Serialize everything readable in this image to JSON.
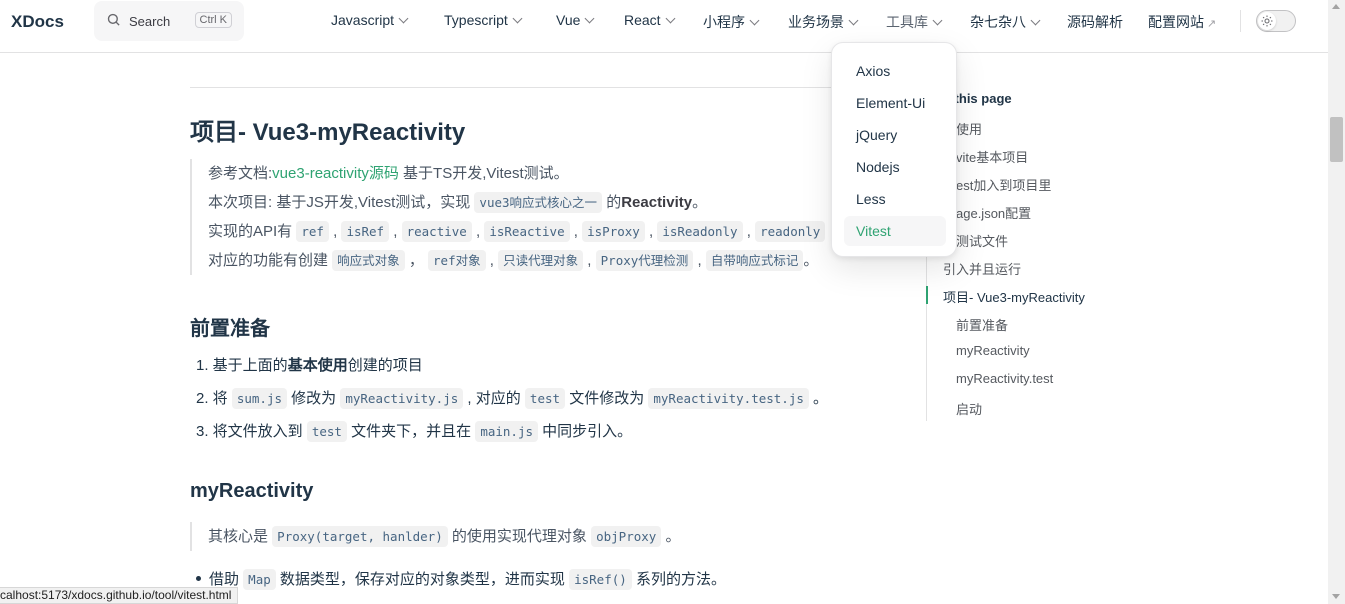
{
  "nav": {
    "logo": "XDocs",
    "search_placeholder": "Search",
    "search_shortcut": "Ctrl K",
    "items": [
      {
        "label": "Javascript",
        "dropdown": true
      },
      {
        "label": "Typescript",
        "dropdown": true
      },
      {
        "label": "Vue",
        "dropdown": true
      },
      {
        "label": "React",
        "dropdown": true
      },
      {
        "label": "小程序",
        "dropdown": true
      },
      {
        "label": "业务场景",
        "dropdown": true
      },
      {
        "label": "工具库",
        "dropdown": true,
        "active": true
      },
      {
        "label": "杂七杂八",
        "dropdown": true
      },
      {
        "label": "源码解析",
        "dropdown": false
      },
      {
        "label": "配置网站",
        "dropdown": false,
        "external": true
      }
    ],
    "external_icon": "↗"
  },
  "dropdown": {
    "items": [
      "Axios",
      "Element-Ui",
      "jQuery",
      "Nodejs",
      "Less",
      "Vitest"
    ],
    "active": "Vitest"
  },
  "article": {
    "title": "项目- Vue3-myReactivity",
    "quote1": {
      "l1_prefix": "参考文档:",
      "l1_link": "vue3-reactivity源码",
      "l1_suffix": " 基于TS开发,Vitest测试。",
      "l2_prefix": "本次项目: 基于JS开发,Vitest测试，实现 ",
      "l2_code": "vue3响应式核心之一",
      "l2_mid": " 的",
      "l2_bold": "Reactivity",
      "l2_suffix": "。",
      "l3_prefix": "实现的API有 ",
      "l3_codes": [
        "ref",
        "isRef",
        "reactive",
        "isReactive",
        "isProxy",
        "isReadonly",
        "readonly"
      ],
      "l4_prefix": "对应的功能有创建 ",
      "l4_codes": [
        "响应式对象",
        "ref对象",
        "只读代理对象",
        "Proxy代理检测",
        "自带响应式标记"
      ],
      "l4_suffix": "。"
    },
    "section1_title": "前置准备",
    "steps": {
      "s1_prefix": "1. 基于上面的",
      "s1_bold": "基本使用",
      "s1_suffix": "创建的项目",
      "s2_prefix": "2. 将 ",
      "s2_code1": "sum.js",
      "s2_mid1": " 修改为 ",
      "s2_code2": "myReactivity.js",
      "s2_mid2": " , 对应的 ",
      "s2_code3": "test",
      "s2_mid3": " 文件修改为 ",
      "s2_code4": "myReactivity.test.js",
      "s2_suffix": " 。",
      "s3_prefix": "3. 将文件放入到 ",
      "s3_code1": "test",
      "s3_mid": " 文件夹下，并且在 ",
      "s3_code2": "main.js",
      "s3_suffix": " 中同步引入。"
    },
    "section2_title": "myReactivity",
    "quote2": {
      "prefix": "其核心是 ",
      "code1": "Proxy(target, hanlder)",
      "mid": " 的使用实现代理对象 ",
      "code2": "objProxy",
      "suffix": " 。"
    },
    "bullet": {
      "prefix": "借助 ",
      "code1": "Map",
      "mid": " 数据类型，保存对应的对象类型，进而实现 ",
      "code2": "isRef()",
      "suffix": " 系列的方法。"
    }
  },
  "toc": {
    "title": "n this page",
    "links": [
      "本使用",
      "建vite基本项目",
      "vitest加入到项目里",
      "ckage.json配置",
      "写测试文件",
      "引入并且运行",
      "项目- Vue3-myReactivity",
      "前置准备",
      "myReactivity",
      "myReactivity.test",
      "启动"
    ],
    "active": "项目- Vue3-myReactivity"
  },
  "status_url": "calhost:5173/xdocs.github.io/tool/vitest.html",
  "colors": {
    "brand": "#2fa372",
    "text": "#213547",
    "code_bg": "#f1f1f1"
  }
}
